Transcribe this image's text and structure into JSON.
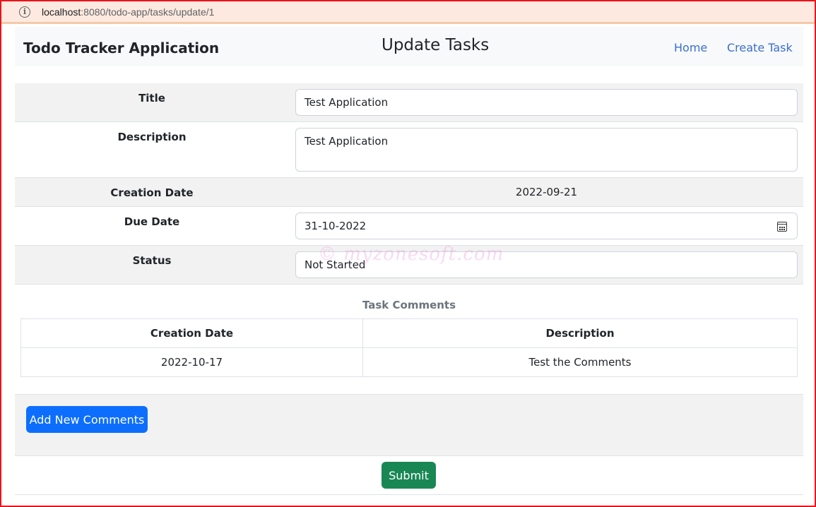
{
  "browser": {
    "url_host": "localhost",
    "url_path": ":8080/todo-app/tasks/update/1",
    "info_icon": "info-icon"
  },
  "navbar": {
    "brand": "Todo Tracker Application",
    "title": "Update Tasks",
    "links": [
      "Home",
      "Create Task"
    ]
  },
  "form": {
    "title_label": "Title",
    "title_value": "Test Application",
    "description_label": "Description",
    "description_value": "Test Application",
    "creation_date_label": "Creation Date",
    "creation_date_value": "2022-09-21",
    "due_date_label": "Due Date",
    "due_date_value": "31-10-2022",
    "status_label": "Status",
    "status_value": "Not Started"
  },
  "watermark": "© myzonesoft.com",
  "comments": {
    "caption": "Task Comments",
    "headers": [
      "Creation Date",
      "Description"
    ],
    "rows": [
      [
        "2022-10-17",
        "Test the Comments"
      ]
    ],
    "add_button": "Add New Comments"
  },
  "submit_button": "Submit",
  "colors": {
    "primary": "#0d6efd",
    "success": "#198754",
    "link": "#3a6fd0",
    "frame": "#e8141c"
  }
}
